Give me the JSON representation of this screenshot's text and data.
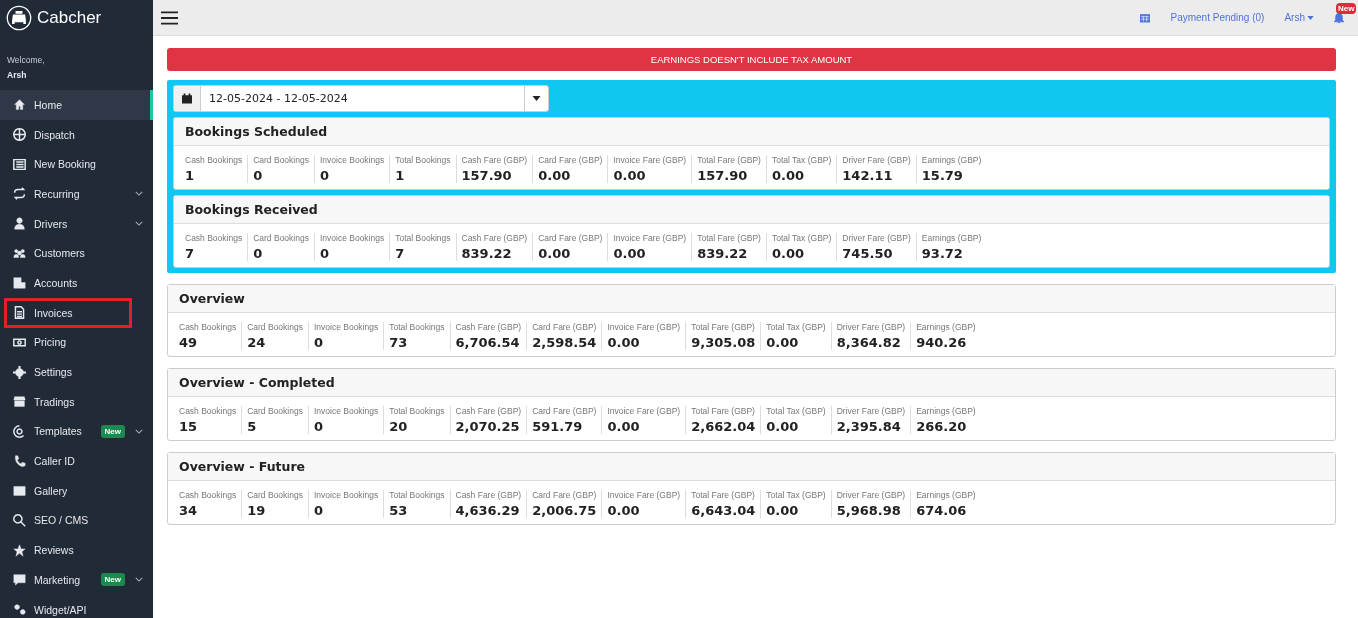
{
  "brand": "Cabcher",
  "welcome": "Welcome,",
  "user": "Arsh",
  "nav": [
    {
      "label": "Home",
      "selected": true,
      "highlighted": false,
      "expandable": false
    },
    {
      "label": "Dispatch",
      "selected": false,
      "highlighted": false,
      "expandable": false
    },
    {
      "label": "New Booking",
      "selected": false,
      "highlighted": false,
      "expandable": false
    },
    {
      "label": "Recurring",
      "selected": false,
      "highlighted": false,
      "expandable": true
    },
    {
      "label": "Drivers",
      "selected": false,
      "highlighted": false,
      "expandable": true
    },
    {
      "label": "Customers",
      "selected": false,
      "highlighted": false,
      "expandable": false
    },
    {
      "label": "Accounts",
      "selected": false,
      "highlighted": false,
      "expandable": false
    },
    {
      "label": "Invoices",
      "selected": false,
      "highlighted": true,
      "expandable": false
    },
    {
      "label": "Pricing",
      "selected": false,
      "highlighted": false,
      "expandable": false
    },
    {
      "label": "Settings",
      "selected": false,
      "highlighted": false,
      "expandable": false
    },
    {
      "label": "Tradings",
      "selected": false,
      "highlighted": false,
      "expandable": false
    },
    {
      "label": "Templates",
      "selected": false,
      "highlighted": false,
      "expandable": true,
      "badge": "New"
    },
    {
      "label": "Caller ID",
      "selected": false,
      "highlighted": false,
      "expandable": false
    },
    {
      "label": "Gallery",
      "selected": false,
      "highlighted": false,
      "expandable": false
    },
    {
      "label": "SEO / CMS",
      "selected": false,
      "highlighted": false,
      "expandable": false
    },
    {
      "label": "Reviews",
      "selected": false,
      "highlighted": false,
      "expandable": false
    },
    {
      "label": "Marketing",
      "selected": false,
      "highlighted": false,
      "expandable": true,
      "badge": "New"
    },
    {
      "label": "Widget/API",
      "selected": false,
      "highlighted": false,
      "expandable": false
    }
  ],
  "topbar": {
    "payment_pending": "Payment Pending (0)",
    "user": "Arsh",
    "notification_badge": "New"
  },
  "alert": "EARNINGS DOESN'T INCLUDE TAX AMOUNT",
  "date_range": "12-05-2024 - 12-05-2024",
  "panels": [
    {
      "title": "Bookings Scheduled",
      "highlighted": true,
      "stats": [
        {
          "label": "Cash Bookings",
          "value": "1"
        },
        {
          "label": "Card Bookings",
          "value": "0"
        },
        {
          "label": "Invoice Bookings",
          "value": "0"
        },
        {
          "label": "Total Bookings",
          "value": "1"
        },
        {
          "label": "Cash Fare (GBP)",
          "value": "157.90"
        },
        {
          "label": "Card Fare (GBP)",
          "value": "0.00"
        },
        {
          "label": "Invoice Fare (GBP)",
          "value": "0.00"
        },
        {
          "label": "Total Fare (GBP)",
          "value": "157.90"
        },
        {
          "label": "Total Tax (GBP)",
          "value": "0.00"
        },
        {
          "label": "Driver Fare (GBP)",
          "value": "142.11"
        },
        {
          "label": "Earnings (GBP)",
          "value": "15.79"
        }
      ]
    },
    {
      "title": "Bookings Received",
      "highlighted": true,
      "stats": [
        {
          "label": "Cash Bookings",
          "value": "7"
        },
        {
          "label": "Card Bookings",
          "value": "0"
        },
        {
          "label": "Invoice Bookings",
          "value": "0"
        },
        {
          "label": "Total Bookings",
          "value": "7"
        },
        {
          "label": "Cash Fare (GBP)",
          "value": "839.22"
        },
        {
          "label": "Card Fare (GBP)",
          "value": "0.00"
        },
        {
          "label": "Invoice Fare (GBP)",
          "value": "0.00"
        },
        {
          "label": "Total Fare (GBP)",
          "value": "839.22"
        },
        {
          "label": "Total Tax (GBP)",
          "value": "0.00"
        },
        {
          "label": "Driver Fare (GBP)",
          "value": "745.50"
        },
        {
          "label": "Earnings (GBP)",
          "value": "93.72"
        }
      ]
    },
    {
      "title": "Overview",
      "highlighted": false,
      "stats": [
        {
          "label": "Cash Bookings",
          "value": "49"
        },
        {
          "label": "Card Bookings",
          "value": "24"
        },
        {
          "label": "Invoice Bookings",
          "value": "0"
        },
        {
          "label": "Total Bookings",
          "value": "73"
        },
        {
          "label": "Cash Fare (GBP)",
          "value": "6,706.54"
        },
        {
          "label": "Card Fare (GBP)",
          "value": "2,598.54"
        },
        {
          "label": "Invoice Fare (GBP)",
          "value": "0.00"
        },
        {
          "label": "Total Fare (GBP)",
          "value": "9,305.08"
        },
        {
          "label": "Total Tax (GBP)",
          "value": "0.00"
        },
        {
          "label": "Driver Fare (GBP)",
          "value": "8,364.82"
        },
        {
          "label": "Earnings (GBP)",
          "value": "940.26"
        }
      ]
    },
    {
      "title": "Overview - Completed",
      "highlighted": false,
      "stats": [
        {
          "label": "Cash Bookings",
          "value": "15"
        },
        {
          "label": "Card Bookings",
          "value": "5"
        },
        {
          "label": "Invoice Bookings",
          "value": "0"
        },
        {
          "label": "Total Bookings",
          "value": "20"
        },
        {
          "label": "Cash Fare (GBP)",
          "value": "2,070.25"
        },
        {
          "label": "Card Fare (GBP)",
          "value": "591.79"
        },
        {
          "label": "Invoice Fare (GBP)",
          "value": "0.00"
        },
        {
          "label": "Total Fare (GBP)",
          "value": "2,662.04"
        },
        {
          "label": "Total Tax (GBP)",
          "value": "0.00"
        },
        {
          "label": "Driver Fare (GBP)",
          "value": "2,395.84"
        },
        {
          "label": "Earnings (GBP)",
          "value": "266.20"
        }
      ]
    },
    {
      "title": "Overview - Future",
      "highlighted": false,
      "stats": [
        {
          "label": "Cash Bookings",
          "value": "34"
        },
        {
          "label": "Card Bookings",
          "value": "19"
        },
        {
          "label": "Invoice Bookings",
          "value": "0"
        },
        {
          "label": "Total Bookings",
          "value": "53"
        },
        {
          "label": "Cash Fare (GBP)",
          "value": "4,636.29"
        },
        {
          "label": "Card Fare (GBP)",
          "value": "2,006.75"
        },
        {
          "label": "Invoice Fare (GBP)",
          "value": "0.00"
        },
        {
          "label": "Total Fare (GBP)",
          "value": "6,643.04"
        },
        {
          "label": "Total Tax (GBP)",
          "value": "0.00"
        },
        {
          "label": "Driver Fare (GBP)",
          "value": "5,968.98"
        },
        {
          "label": "Earnings (GBP)",
          "value": "674.06"
        }
      ]
    }
  ]
}
